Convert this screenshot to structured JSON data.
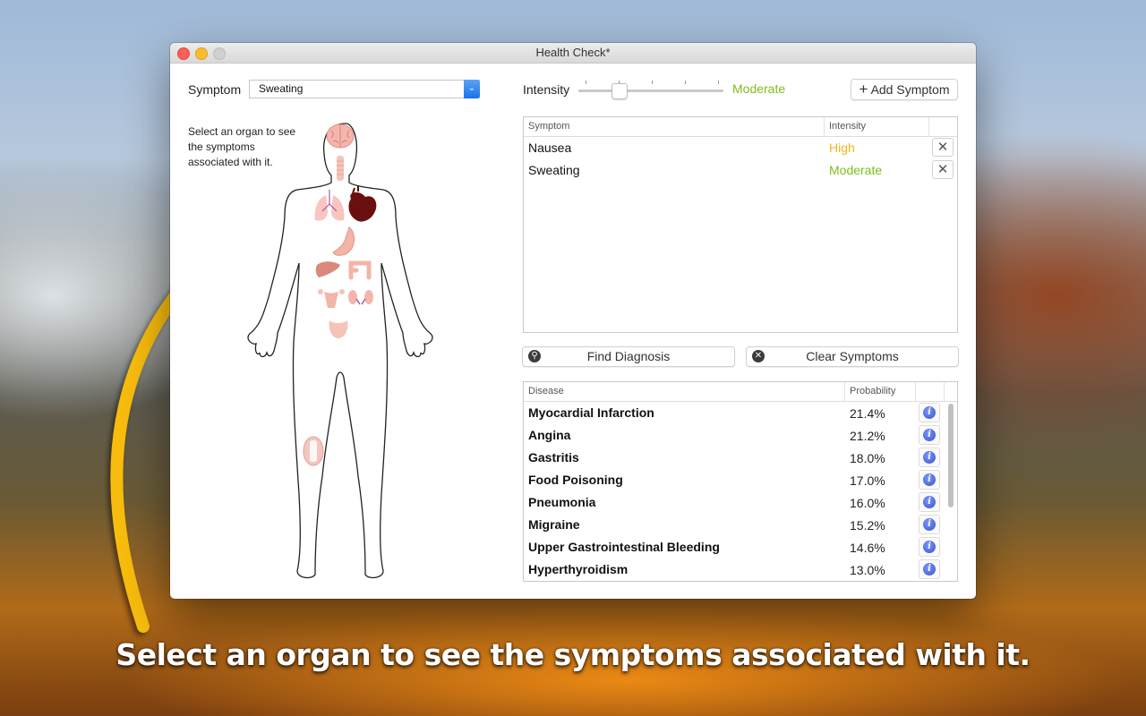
{
  "window": {
    "title": "Health Check*"
  },
  "symptom_picker": {
    "label": "Symptom",
    "selected": "Sweating"
  },
  "hint_text": "Select an organ to see the symptoms associated with it.",
  "intensity": {
    "label": "Intensity",
    "value_label": "Moderate",
    "value_color": "#7fbf1a",
    "level_index": 1,
    "level_count": 5
  },
  "add_symptom_button": {
    "icon": "plus-icon",
    "label": "Add Symptom"
  },
  "symptom_table": {
    "columns": [
      "Symptom",
      "Intensity"
    ],
    "rows": [
      {
        "symptom": "Nausea",
        "intensity": "High",
        "color": "#f5b41e"
      },
      {
        "symptom": "Sweating",
        "intensity": "Moderate",
        "color": "#7fbf1a"
      }
    ]
  },
  "find_diagnosis_button": {
    "icon": "search-icon",
    "label": "Find Diagnosis"
  },
  "clear_symptoms_button": {
    "icon": "clear-icon",
    "label": "Clear Symptoms"
  },
  "disease_table": {
    "columns": [
      "Disease",
      "Probability"
    ],
    "rows": [
      {
        "disease": "Myocardial Infarction",
        "probability": "21.4%"
      },
      {
        "disease": "Angina",
        "probability": "21.2%"
      },
      {
        "disease": "Gastritis",
        "probability": "18.0%"
      },
      {
        "disease": "Food Poisoning",
        "probability": "17.0%"
      },
      {
        "disease": "Pneumonia",
        "probability": "16.0%"
      },
      {
        "disease": "Migraine",
        "probability": "15.2%"
      },
      {
        "disease": "Upper Gastrointestinal Bleeding",
        "probability": "14.6%"
      },
      {
        "disease": "Hyperthyroidism",
        "probability": "13.0%"
      }
    ]
  },
  "organs": [
    "brain",
    "throat",
    "lungs",
    "heart",
    "stomach",
    "liver",
    "intestine",
    "uterus",
    "kidneys",
    "bladder",
    "joint"
  ],
  "caption": "Select an organ to see the symptoms associated with it.",
  "accent_arrow_color": "#f7bc0a"
}
